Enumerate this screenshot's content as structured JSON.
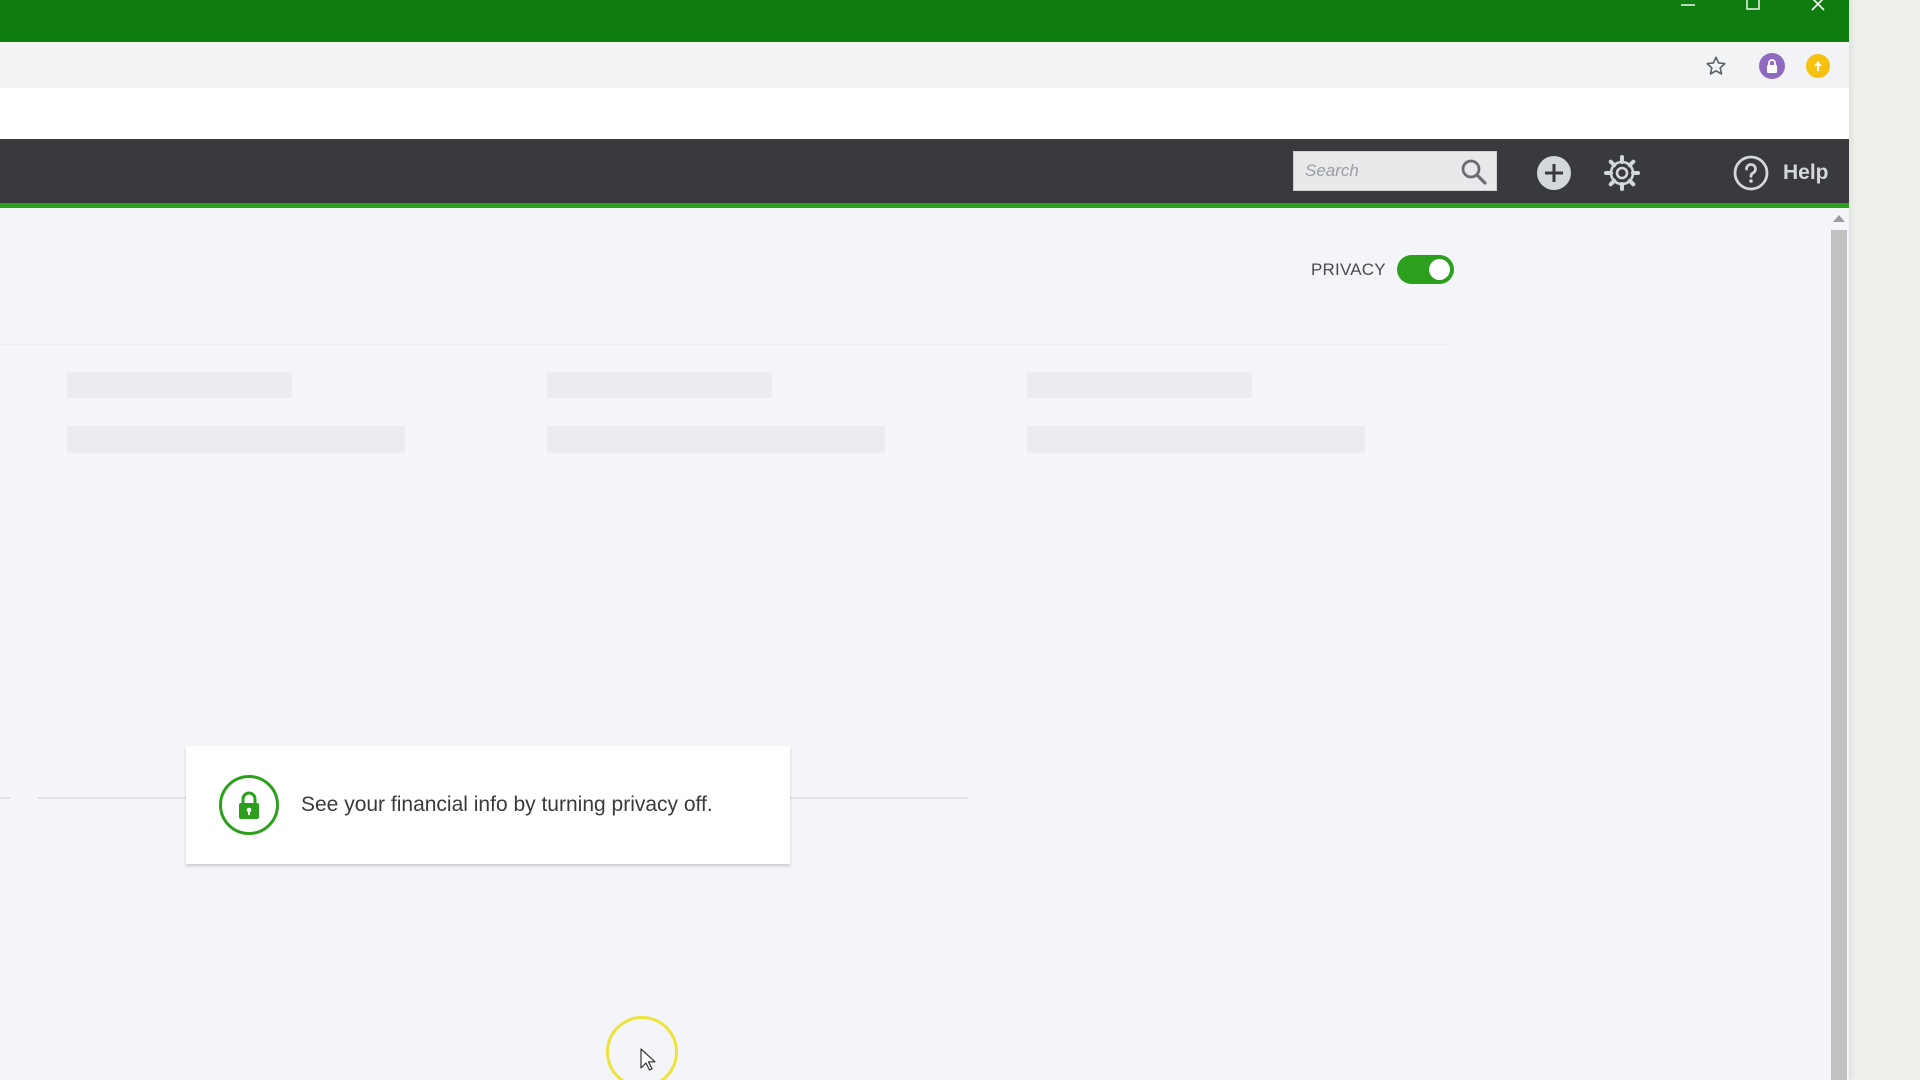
{
  "window": {
    "controls": {
      "minimize": "minimize-icon",
      "maximize": "maximize-icon",
      "close": "close-icon"
    }
  },
  "toolbar": {
    "bookmark_icon": "star-icon",
    "extensions": [
      "extension-purple-icon",
      "extension-yellow-icon"
    ]
  },
  "appbar": {
    "search_placeholder": "Search",
    "search_icon": "search-icon",
    "add_icon": "plus-circle-icon",
    "settings_icon": "gear-icon",
    "help_label": "Help",
    "help_icon": "question-circle-icon"
  },
  "content": {
    "privacy_label": "PRIVACY",
    "privacy_on": true,
    "privacy_message": "See your financial info by turning privacy off.",
    "lock_icon": "lock-icon"
  },
  "colors": {
    "titlebar": "#0f7c10",
    "appbar": "#393a3d",
    "accent_green": "#2ca01c"
  }
}
